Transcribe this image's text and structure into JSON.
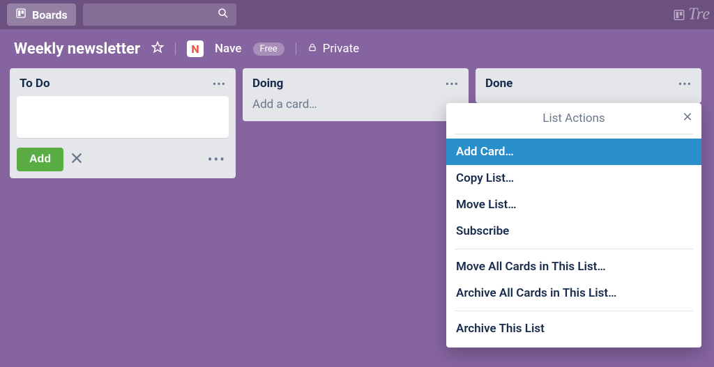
{
  "header": {
    "boards_label": "Boards",
    "brand_text": "Tre"
  },
  "board": {
    "title": "Weekly newsletter",
    "badge_letter": "N",
    "workspace_name": "Nave",
    "plan_label": "Free",
    "privacy_label": "Private"
  },
  "lists": {
    "todo": {
      "title": "To Do",
      "add_button": "Add"
    },
    "doing": {
      "title": "Doing",
      "add_card_prompt": "Add a card…"
    },
    "done": {
      "title": "Done"
    }
  },
  "popover": {
    "title": "List Actions",
    "items": {
      "add_card": "Add Card…",
      "copy_list": "Copy List…",
      "move_list": "Move List…",
      "subscribe": "Subscribe",
      "move_all": "Move All Cards in This List…",
      "archive_all": "Archive All Cards in This List…",
      "archive_list": "Archive This List"
    }
  },
  "colors": {
    "bg": "#8664a0",
    "list_bg": "#e4e6ea",
    "add_btn": "#5aac44",
    "highlight": "#298fca"
  }
}
